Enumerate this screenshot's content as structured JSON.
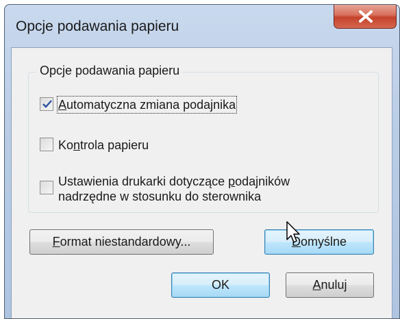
{
  "window": {
    "title": "Opcje podawania papieru"
  },
  "group": {
    "legend": "Opcje podawania papieru",
    "options": [
      {
        "label_accel": "A",
        "label_rest": "utomatyczna zmiana podajnika",
        "checked": true
      },
      {
        "label_pre": "Ko",
        "label_accel": "n",
        "label_rest": "trola papieru",
        "checked": false
      },
      {
        "label_pre": "Ustawienia drukarki dotyczące ",
        "label_accel": "p",
        "label_rest": "odajników nadrzędne w stosunku do sterownika",
        "checked": false
      }
    ]
  },
  "buttons": {
    "custom_format": {
      "accel": "F",
      "rest": "ormat niestandardowy..."
    },
    "defaults": {
      "accel": "D",
      "rest": "omyślne"
    },
    "ok": "OK",
    "cancel": {
      "accel": "A",
      "rest": "nuluj"
    }
  },
  "icons": {
    "close": "close-icon",
    "check": "checkmark-icon",
    "cursor": "mouse-pointer-icon"
  },
  "colors": {
    "close_button": "#c5432c",
    "checkmark": "#2a4fa3",
    "default_button_border": "#3c7fb1"
  }
}
